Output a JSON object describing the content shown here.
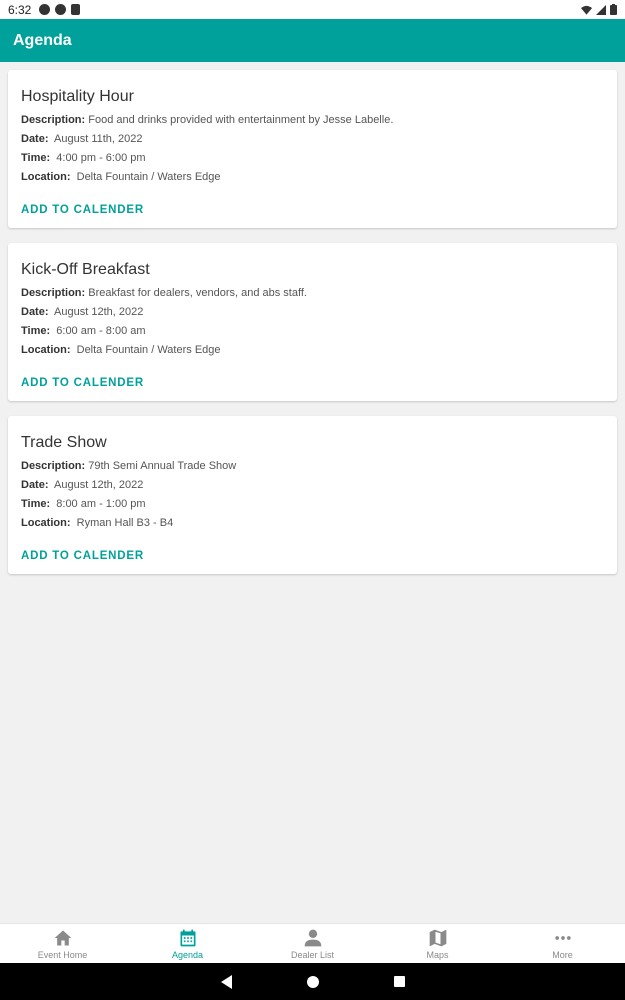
{
  "status_bar": {
    "time": "6:32"
  },
  "app_bar": {
    "title": "Agenda"
  },
  "labels": {
    "description": "Description:",
    "date": "Date:",
    "time": "Time:",
    "location": "Location:"
  },
  "events": [
    {
      "title": "Hospitality Hour",
      "description": "Food and drinks provided with entertainment by Jesse Labelle.",
      "date": "August 11th, 2022",
      "time": "4:00 pm - 6:00 pm",
      "location": "Delta Fountain / Waters Edge",
      "action": "ADD TO CALENDER"
    },
    {
      "title": "Kick-Off Breakfast",
      "description": "Breakfast for dealers, vendors, and abs staff.",
      "date": "August 12th, 2022",
      "time": "6:00 am - 8:00 am",
      "location": "Delta Fountain / Waters Edge",
      "action": "ADD TO CALENDER"
    },
    {
      "title": "Trade Show",
      "description": "79th Semi Annual Trade Show",
      "date": "August 12th, 2022",
      "time": "8:00 am - 1:00 pm",
      "location": "Ryman Hall B3 - B4",
      "action": "ADD TO CALENDER"
    }
  ],
  "bottom_nav": [
    {
      "label": "Event Home",
      "icon": "home-icon",
      "active": false
    },
    {
      "label": "Agenda",
      "icon": "calendar-icon",
      "active": true
    },
    {
      "label": "Dealer List",
      "icon": "person-icon",
      "active": false
    },
    {
      "label": "Maps",
      "icon": "map-icon",
      "active": false
    },
    {
      "label": "More",
      "icon": "more-icon",
      "active": false
    }
  ],
  "colors": {
    "accent": "#00a19a",
    "background": "#f2f1f2",
    "inactive": "#8a8a8a"
  }
}
